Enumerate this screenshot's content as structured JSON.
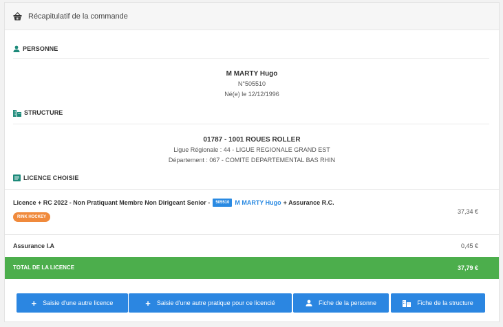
{
  "header": {
    "title": "Récapitulatif de la commande",
    "icon": "basket-icon"
  },
  "personne": {
    "section_label": "PERSONNE",
    "name": "M MARTY Hugo",
    "number": "N°505510",
    "birth": "Né(e) le 12/12/1996"
  },
  "structure": {
    "section_label": "STRUCTURE",
    "name": "01787 - 1001 ROUES ROLLER",
    "ligue": "Ligue Régionale : 44 - LIGUE REGIONALE GRAND EST",
    "departement": "Département : 067 - COMITE DEPARTEMENTAL BAS RHIN"
  },
  "licence": {
    "section_label": "LICENCE CHOISIE",
    "line_prefix": "Licence + RC 2022 - Non Pratiquant Membre Non Dirigeant Senior -",
    "number_badge": "505510",
    "person_link": "M MARTY Hugo",
    "line_suffix": "+ Assurance R.C.",
    "discipline_badge": "RINK HOCKEY",
    "price": "37,34 €"
  },
  "assurance": {
    "label": "Assurance I.A",
    "price": "0,45 €"
  },
  "total": {
    "label": "TOTAL DE LA LICENCE",
    "value": "37,79 €",
    "color": "#4cae4c"
  },
  "buttons": {
    "autre_licence": "Saisie d'une autre licence",
    "autre_pratique": "Saisie d'une autre pratique pour ce licencié",
    "fiche_personne": "Fiche de la personne",
    "fiche_structure": "Fiche de la structure"
  },
  "colors": {
    "primary": "#2b86e1",
    "success": "#4cae4c",
    "badge_orange": "#f08a3c",
    "icon_teal": "#1d8a7a"
  }
}
